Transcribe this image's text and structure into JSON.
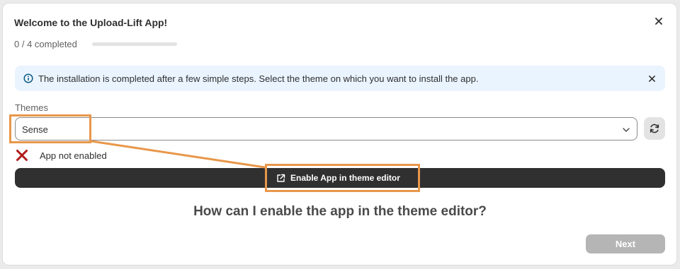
{
  "header": {
    "title": "Welcome to the Upload-Lift App!",
    "close_icon": "close-icon"
  },
  "progress": {
    "text": "0 / 4 completed",
    "completed": 0,
    "total": 4,
    "fraction": 0
  },
  "banner": {
    "text": "The installation is completed after a few simple steps. Select the theme on which you want to install the app.",
    "icon": "info-icon",
    "close_icon": "close-icon",
    "background": "#eaf4ff"
  },
  "themes": {
    "label": "Themes",
    "selected": "Sense",
    "chevron_icon": "chevron-down-icon",
    "refresh_icon": "refresh-icon"
  },
  "status": {
    "text": "App not enabled",
    "icon": "cross-icon",
    "color": "#b11a1a"
  },
  "enable_button": {
    "label": "Enable App in theme editor",
    "icon": "external-link-icon",
    "background": "#303030"
  },
  "help": {
    "title": "How can I enable the app in the theme editor?"
  },
  "footer": {
    "next_label": "Next"
  },
  "annotation": {
    "color": "#e8974a"
  }
}
